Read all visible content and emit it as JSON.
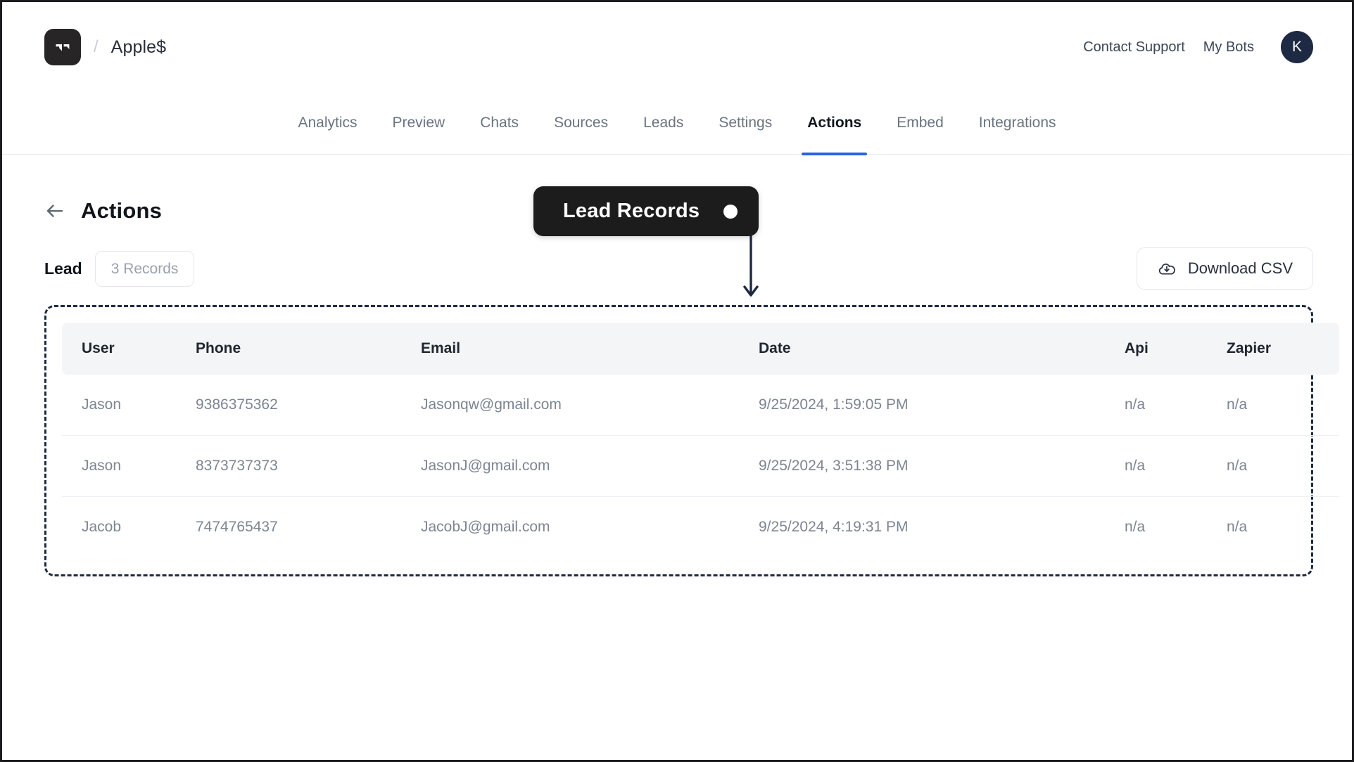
{
  "topbar": {
    "logo_icon": "bot-logo-icon",
    "breadcrumb_separator": "/",
    "brand_name": "Apple$",
    "contact_support": "Contact Support",
    "my_bots": "My Bots",
    "avatar_initial": "K"
  },
  "nav": {
    "tabs": [
      {
        "label": "Analytics",
        "active": false
      },
      {
        "label": "Preview",
        "active": false
      },
      {
        "label": "Chats",
        "active": false
      },
      {
        "label": "Sources",
        "active": false
      },
      {
        "label": "Leads",
        "active": false
      },
      {
        "label": "Settings",
        "active": false
      },
      {
        "label": "Actions",
        "active": true
      },
      {
        "label": "Embed",
        "active": false
      },
      {
        "label": "Integrations",
        "active": false
      }
    ],
    "active_color": "#2563eb"
  },
  "page": {
    "back_icon": "back-arrow-icon",
    "title": "Actions",
    "lead_label": "Lead",
    "records_badge": "3 Records",
    "download_label": "Download CSV",
    "download_icon": "cloud-download-icon"
  },
  "callout": {
    "label": "Lead Records",
    "dot_icon": "callout-dot-icon",
    "arrow_icon": "down-arrow-icon",
    "background": "#1c1c1c",
    "arrow_color": "#1e2a44"
  },
  "table": {
    "columns": [
      "User",
      "Phone",
      "Email",
      "Date",
      "Api",
      "Zapier"
    ],
    "rows": [
      {
        "user": "Jason",
        "phone": "9386375362",
        "email": "Jasonqw@gmail.com",
        "date": "9/25/2024, 1:59:05 PM",
        "api": "n/a",
        "zapier": "n/a"
      },
      {
        "user": "Jason",
        "phone": "8373737373",
        "email": "JasonJ@gmail.com",
        "date": "9/25/2024, 3:51:38 PM",
        "api": "n/a",
        "zapier": "n/a"
      },
      {
        "user": "Jacob",
        "phone": "7474765437",
        "email": "JacobJ@gmail.com",
        "date": "9/25/2024, 4:19:31 PM",
        "api": "n/a",
        "zapier": "n/a"
      }
    ]
  }
}
